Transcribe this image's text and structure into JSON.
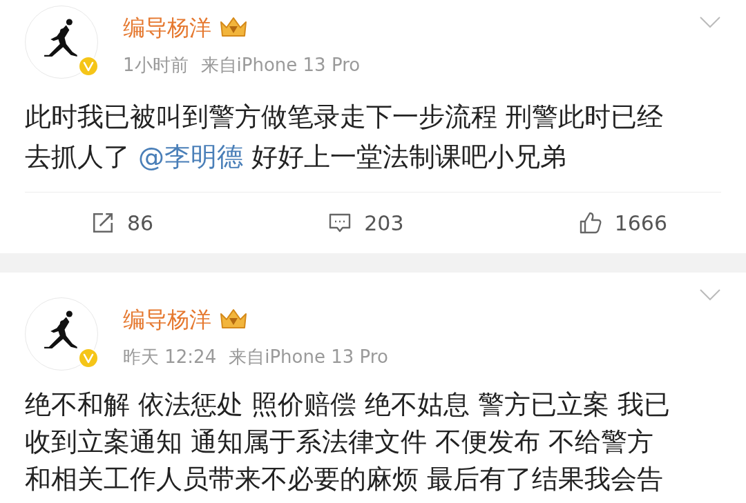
{
  "posts": [
    {
      "author": "编导杨洋",
      "crown": true,
      "verified": true,
      "time": "1小时前",
      "source": "来自iPhone 13 Pro",
      "lines": [
        [
          {
            "kind": "text",
            "text": "此时我已被叫到警方做笔录走下一步流程 刑警此时已经"
          }
        ],
        [
          {
            "kind": "text",
            "text": "去抓人了 "
          },
          {
            "kind": "mention",
            "text": "@李明德"
          },
          {
            "kind": "text",
            "text": " 好好上一堂法制课吧小兄弟"
          }
        ]
      ],
      "actions": [
        {
          "kind": "repost",
          "count": "86"
        },
        {
          "kind": "comment",
          "count": "203"
        },
        {
          "kind": "like",
          "count": "1666"
        }
      ]
    },
    {
      "author": "编导杨洋",
      "crown": true,
      "verified": true,
      "time": "昨天 12:24",
      "source": "来自iPhone 13 Pro",
      "lines": [
        [
          {
            "kind": "text",
            "text": "绝不和解 依法惩处 照价赔偿 绝不姑息 警方已立案 我已"
          }
        ],
        [
          {
            "kind": "text",
            "text": "收到立案通知 通知属于系法律文件 不便发布 不给警方"
          }
        ],
        [
          {
            "kind": "text",
            "text": "和相关工作人员带来不必要的麻烦 最后有了结果我会告"
          }
        ]
      ]
    }
  ]
}
